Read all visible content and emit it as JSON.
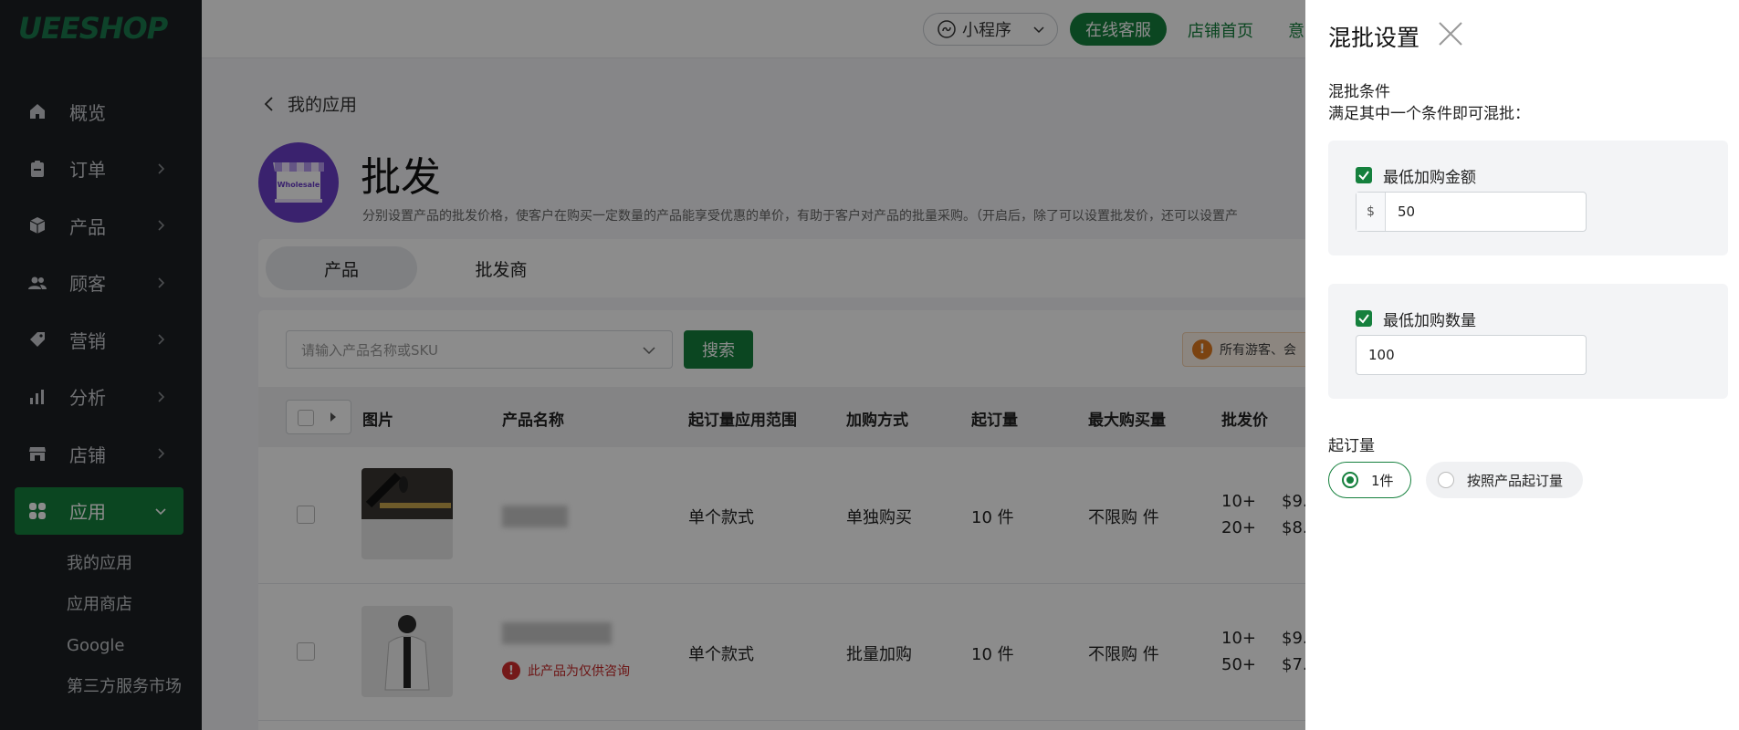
{
  "sidebar": {
    "logo": "UEESHOP",
    "items": [
      {
        "label": "概览",
        "icon": "home-icon"
      },
      {
        "label": "订单",
        "icon": "clipboard-icon"
      },
      {
        "label": "产品",
        "icon": "box-icon"
      },
      {
        "label": "顾客",
        "icon": "users-icon"
      },
      {
        "label": "营销",
        "icon": "tag-icon"
      },
      {
        "label": "分析",
        "icon": "bar-chart-icon"
      },
      {
        "label": "店铺",
        "icon": "store-icon"
      },
      {
        "label": "应用",
        "icon": "apps-icon"
      }
    ],
    "sub_items": [
      "我的应用",
      "应用商店",
      "Google",
      "第三方服务市场"
    ]
  },
  "topbar": {
    "mini_program": "小程序",
    "online_service": "在线客服",
    "store_home": "店铺首页",
    "more": "意"
  },
  "page": {
    "back_label": "我的应用",
    "app_icon_text": "Wholesale",
    "app_title": "批发",
    "app_desc": "分别设置产品的批发价格，使客户在购买一定数量的产品能享受优惠的单价，有助于客户对产品的批量采购。（开启后，除了可以设置批发价，还可以设置产"
  },
  "tabs": [
    "产品",
    "批发商"
  ],
  "search": {
    "placeholder": "请输入产品名称或SKU",
    "button": "搜索"
  },
  "notice": {
    "text": "所有游客、会"
  },
  "table": {
    "headers": [
      "图片",
      "产品名称",
      "起订量应用范围",
      "加购方式",
      "起订量",
      "最大购买量",
      "批发价"
    ],
    "rows": [
      {
        "scope": "单个款式",
        "method": "单独购买",
        "moq": "10 件",
        "max": "不限购 件",
        "tiers": [
          "10+",
          "20+"
        ],
        "prices": [
          "$9.",
          "$8."
        ]
      },
      {
        "scope": "单个款式",
        "method": "批量加购",
        "moq": "10 件",
        "max": "不限购 件",
        "tiers": [
          "10+",
          "50+"
        ],
        "prices": [
          "$9.",
          "$7."
        ],
        "consult": "此产品为仅供咨询"
      }
    ]
  },
  "drawer": {
    "title": "混批设置",
    "condition_label": "混批条件",
    "condition_desc": "满足其中一个条件即可混批：",
    "min_amount": {
      "label": "最低加购金额",
      "prefix": "$",
      "value": "50"
    },
    "min_qty": {
      "label": "最低加购数量",
      "value": "100"
    },
    "moq_label": "起订量",
    "moq_options": [
      "1件",
      "按照产品起订量"
    ]
  },
  "colors": {
    "accent": "#15803d",
    "sidebar_bg": "#1d2023"
  }
}
